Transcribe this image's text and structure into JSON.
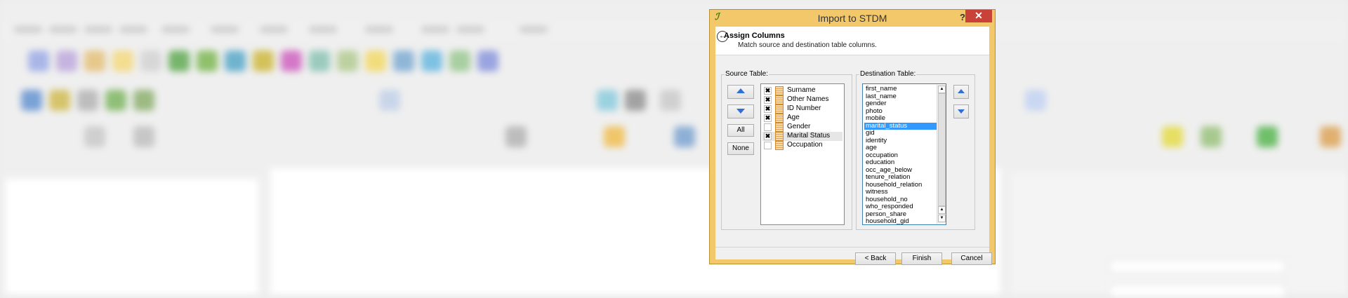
{
  "dialog": {
    "title": "Import to STDM",
    "help_label": "?",
    "close_label": "✕",
    "app_icon": "qgis-icon",
    "header": {
      "title": "Assign Columns",
      "subtitle": "Match source and destination table columns."
    },
    "source_table": {
      "label": "Source Table:",
      "buttons": {
        "up_icon": "arrow-up-icon",
        "down_icon": "arrow-down-icon",
        "all_label": "All",
        "none_label": "None"
      },
      "items": [
        {
          "label": "Surname",
          "checked": true,
          "mark": "✖"
        },
        {
          "label": "Other Names",
          "checked": true,
          "mark": "✖"
        },
        {
          "label": "ID Number",
          "checked": true,
          "mark": "✖"
        },
        {
          "label": "Age",
          "checked": true,
          "mark": "✖"
        },
        {
          "label": "Gender",
          "checked": false,
          "mark": ""
        },
        {
          "label": "Marital Status",
          "checked": true,
          "mark": "✖"
        },
        {
          "label": "Occupation",
          "checked": false,
          "mark": ""
        }
      ]
    },
    "destination_table": {
      "label": "Destination Table:",
      "selected": "marital_status",
      "items": [
        "first_name",
        "last_name",
        "gender",
        "photo",
        "mobile",
        "marital_status",
        "gid",
        "identity",
        "age",
        "occupation",
        "education",
        "occ_age_below",
        "tenure_relation",
        "household_relation",
        "witness",
        "household_no",
        "who_responded",
        "person_share",
        "household_gid"
      ]
    },
    "footer": {
      "back_label": "< Back",
      "finish_label": "Finish",
      "cancel_label": "Cancel"
    },
    "colors": {
      "frame": "#f3c86a",
      "close": "#c9423a",
      "selection": "#3399ff",
      "arrow": "#2f6fd6"
    }
  }
}
